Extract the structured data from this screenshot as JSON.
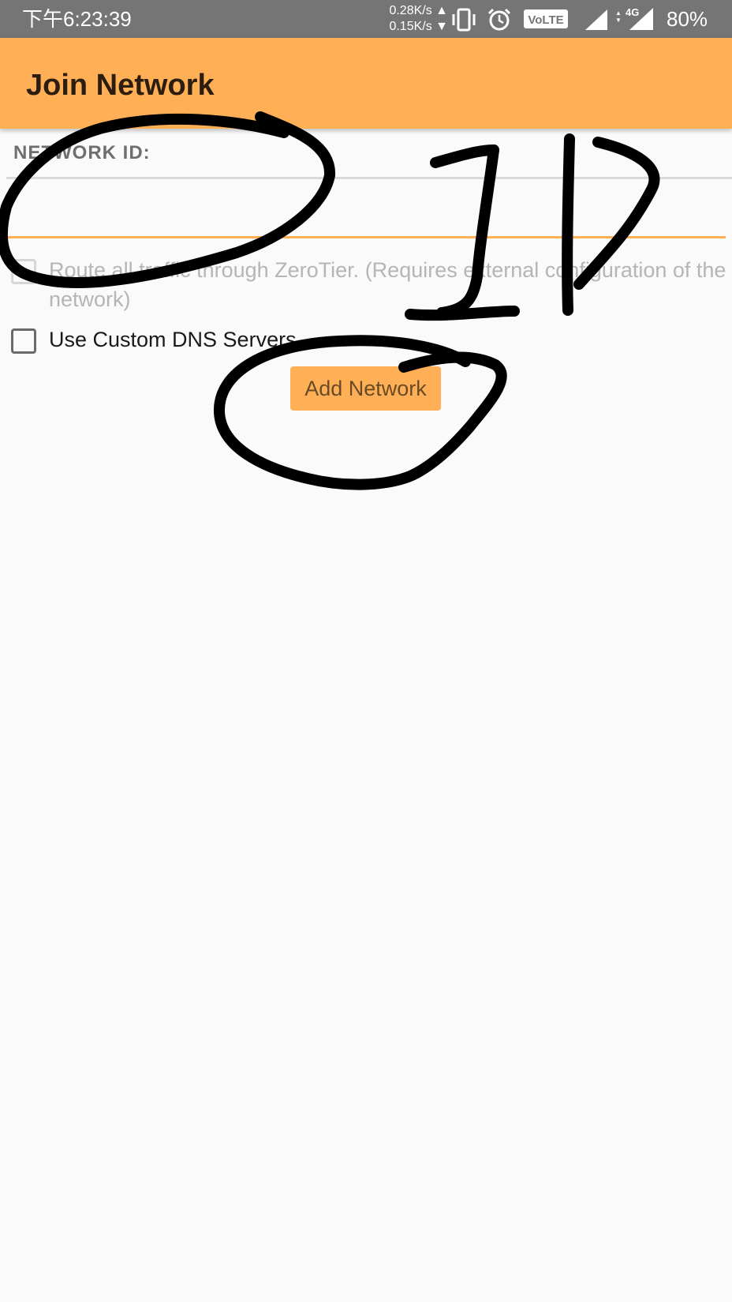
{
  "status_bar": {
    "time": "下午6:23:39",
    "upload_speed": "0.28K/s",
    "download_speed": "0.15K/s",
    "volte_label": "VoLTE",
    "network_type": "4G",
    "battery": "80%"
  },
  "app_bar": {
    "title": "Join Network"
  },
  "form": {
    "network_id_label": "NETWORK ID:",
    "network_id_value": "",
    "route_all_label": "Route all traffic through ZeroTier. (Requires external configuration of the network)",
    "custom_dns_label": "Use Custom DNS Servers",
    "add_button_label": "Add Network"
  },
  "colors": {
    "accent": "#ffb056",
    "status_bar": "#757575",
    "background": "#fafafa"
  },
  "icons": [
    "vibrate-icon",
    "alarm-icon",
    "volte-icon",
    "signal-icon",
    "signal-4g-icon"
  ]
}
